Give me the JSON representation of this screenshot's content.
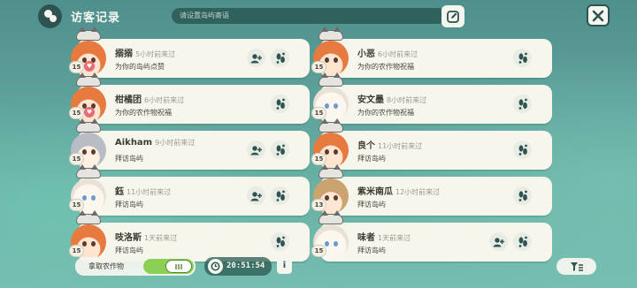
{
  "window": {
    "title": "访客记录"
  },
  "search": {
    "placeholder": "请设置岛屿寄语"
  },
  "visitors_left": [
    {
      "name": "搦搦",
      "time": "5小时前来过",
      "action": "为你的岛屿点赞",
      "level": "15",
      "has_heart": true,
      "hair": "orange",
      "has_add_friend": true
    },
    {
      "name": "柑橘团",
      "time": "6小时前来过",
      "action": "为你的农作物祝福",
      "level": "15",
      "has_heart": true,
      "hair": "orange",
      "has_add_friend": false
    },
    {
      "name": "Aikham",
      "time": "9小时前来过",
      "action": "拜访岛屿",
      "level": "15",
      "has_heart": false,
      "hair": "gray",
      "has_add_friend": true
    },
    {
      "name": "鈺",
      "time": "11小时前来过",
      "action": "拜访岛屿",
      "level": "15",
      "has_heart": false,
      "hair": "white",
      "has_add_friend": true
    },
    {
      "name": "吱洛斯",
      "time": "1天前来过",
      "action": "拜访岛屿",
      "level": "15",
      "has_heart": false,
      "hair": "orange",
      "has_add_friend": false
    }
  ],
  "visitors_right": [
    {
      "name": "小恶",
      "time": "6小时前来过",
      "action": "为你的农作物祝福",
      "level": "15",
      "has_heart": false,
      "hair": "orange",
      "has_add_friend": false
    },
    {
      "name": "安文墨",
      "time": "8小时前来过",
      "action": "为你的农作物祝福",
      "level": "15",
      "has_heart": false,
      "hair": "white",
      "has_add_friend": false
    },
    {
      "name": "良个",
      "time": "11小时前来过",
      "action": "拜访岛屿",
      "level": "15",
      "has_heart": false,
      "hair": "orange",
      "has_add_friend": false
    },
    {
      "name": "紫米南瓜",
      "time": "12小时前来过",
      "action": "拜访岛屿",
      "level": "13",
      "has_heart": false,
      "hair": "blond",
      "has_add_friend": false
    },
    {
      "name": "味者",
      "time": "1天前来过",
      "action": "拜访岛屿",
      "level": "15",
      "has_heart": false,
      "hair": "white",
      "has_add_friend": true
    }
  ],
  "bottom": {
    "harvest_label": "拿取农作物",
    "harvest_toggle_on": true,
    "timer": "20:51:54",
    "info": "i"
  },
  "colors": {
    "accent": "#8bcf55",
    "card": "#f7f6ec",
    "heart": "#e86c74",
    "dark": "#2e5350"
  },
  "icons": [
    "search-edit-icon",
    "close-icon",
    "footprint-icon",
    "add-friend-icon",
    "clock-icon",
    "info-icon",
    "filter-icon"
  ]
}
